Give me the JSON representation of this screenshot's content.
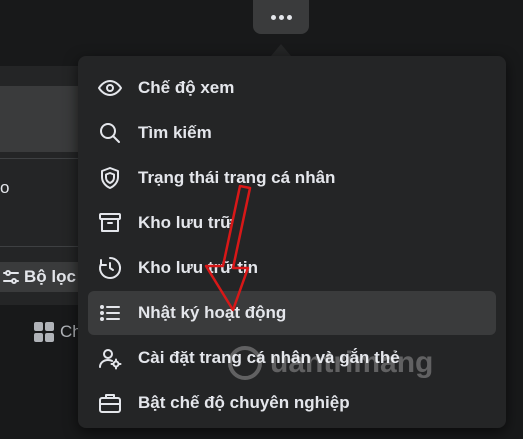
{
  "background": {
    "filter_label": "Bộ lọc",
    "grid_label": "Ch",
    "left_text": "o"
  },
  "menu": {
    "items": [
      {
        "label": "Chế độ xem",
        "icon": "eye-icon"
      },
      {
        "label": "Tìm kiếm",
        "icon": "search-icon"
      },
      {
        "label": "Trạng thái trang cá nhân",
        "icon": "shield-icon"
      },
      {
        "label": "Kho lưu trữ",
        "icon": "archive-box-icon"
      },
      {
        "label": "Kho lưu trữ tin",
        "icon": "story-archive-clock-icon"
      },
      {
        "label": "Nhật ký hoạt động",
        "icon": "list-icon"
      },
      {
        "label": "Cài đặt trang cá nhân và gắn thẻ",
        "icon": "user-gear-icon"
      },
      {
        "label": "Bật chế độ chuyên nghiệp",
        "icon": "briefcase-icon"
      }
    ],
    "active_index": 5
  },
  "watermark": {
    "text": "uantrimang"
  },
  "colors": {
    "background": "#18191a",
    "menu": "#242526",
    "hover": "#3a3b3c",
    "text": "#e4e6eb",
    "annotation_arrow": "#d81818"
  }
}
